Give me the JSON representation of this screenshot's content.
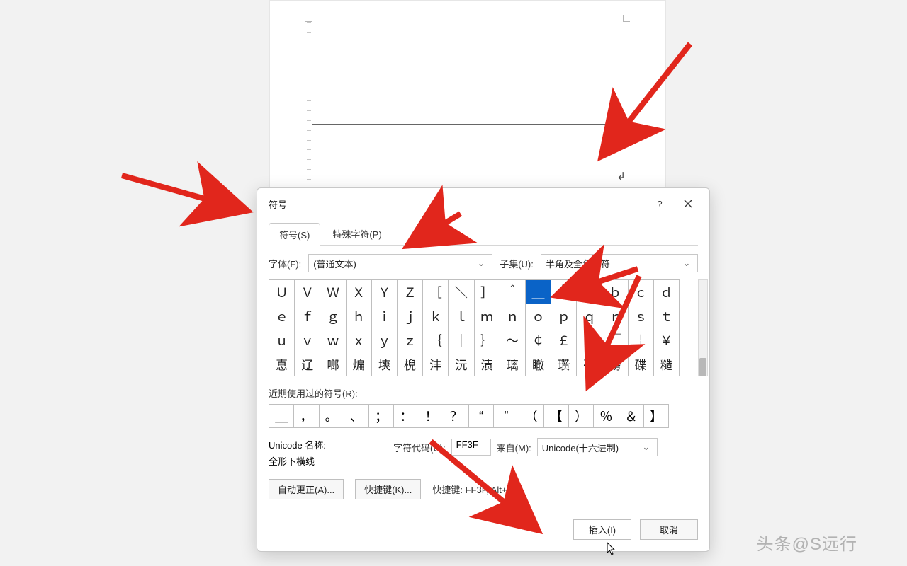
{
  "dialog": {
    "title": "符号",
    "help": "?"
  },
  "tabs": [
    "符号(S)",
    "特殊字符(P)"
  ],
  "font": {
    "label": "字体(F):",
    "value": "(普通文本)"
  },
  "subset": {
    "label": "子集(U):",
    "value": "半角及全角字符"
  },
  "grid": {
    "selected": [
      0,
      10
    ],
    "rows": [
      [
        "Ｕ",
        "Ｖ",
        "Ｗ",
        "Ｘ",
        "Ｙ",
        "Ｚ",
        "［",
        "＼",
        "］",
        "＾",
        "＿",
        "｀",
        "ａ",
        "ｂ",
        "ｃ",
        "ｄ"
      ],
      [
        "ｅ",
        "ｆ",
        "ｇ",
        "ｈ",
        "ｉ",
        "ｊ",
        "ｋ",
        "ｌ",
        "ｍ",
        "ｎ",
        "ｏ",
        "ｐ",
        "ｑ",
        "ｒ",
        "ｓ",
        "ｔ"
      ],
      [
        "ｕ",
        "ｖ",
        "ｗ",
        "ｘ",
        "ｙ",
        "ｚ",
        "｛",
        "｜",
        "｝",
        "～",
        "￠",
        "￡",
        "￢",
        "￣",
        "￤",
        "￥"
      ],
      [
        "惪",
        "辽",
        "啷",
        "煸",
        "塽",
        "棿",
        "沣",
        "沅",
        "渍",
        "璃",
        "瞮",
        "瓒",
        "碍",
        "磅",
        "碟",
        "糙"
      ]
    ]
  },
  "recent": {
    "label": "近期使用过的符号(R):",
    "items": [
      "＿",
      "，",
      "。",
      "、",
      "；",
      "：",
      "！",
      "？",
      "“",
      "”",
      "（",
      "【",
      "）",
      "％",
      "＆",
      "】"
    ]
  },
  "unicode": {
    "nameLabel": "Unicode 名称:",
    "nameValue": "全形下橫线",
    "codeLabel": "字符代码(C):",
    "codeValue": "FF3F",
    "fromLabel": "来自(M):",
    "fromValue": "Unicode(十六进制)"
  },
  "shortcut": {
    "label": "快捷键:",
    "value": "FF3F, Alt+X"
  },
  "buttons": {
    "autocorrect": "自动更正(A)...",
    "shortcut": "快捷键(K)...",
    "insert": "插入(I)",
    "cancel": "取消"
  },
  "watermark": "头条@S远行"
}
